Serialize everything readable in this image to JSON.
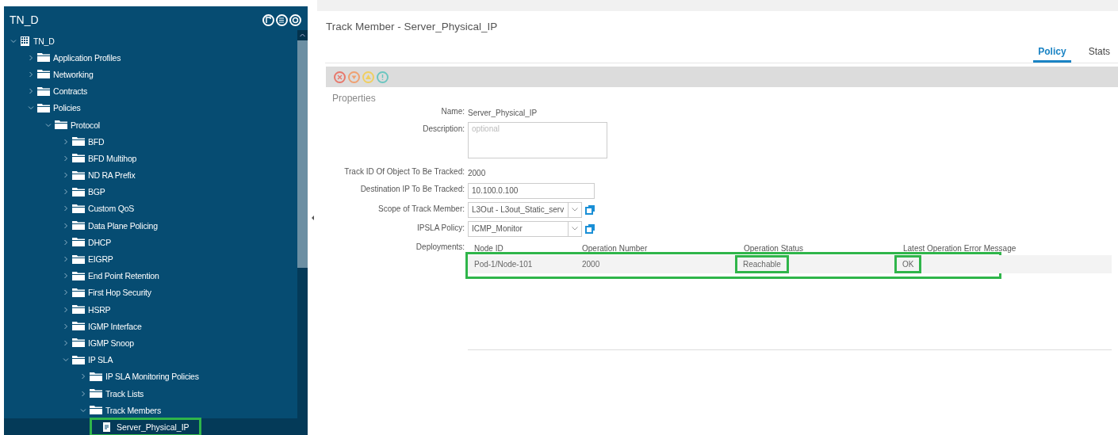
{
  "sidebar": {
    "title": "TN_D",
    "tree": [
      {
        "label": "TN_D",
        "kind": "tenant",
        "expanded": true,
        "selected": false,
        "children": [
          {
            "label": "Application Profiles",
            "kind": "folder",
            "expanded": false,
            "selected": false
          },
          {
            "label": "Networking",
            "kind": "folder",
            "expanded": false,
            "selected": false
          },
          {
            "label": "Contracts",
            "kind": "folder",
            "expanded": false,
            "selected": false
          },
          {
            "label": "Policies",
            "kind": "folder",
            "expanded": true,
            "selected": false,
            "children": [
              {
                "label": "Protocol",
                "kind": "folder",
                "expanded": true,
                "selected": false,
                "children": [
                  {
                    "label": "BFD",
                    "kind": "folder",
                    "expanded": false,
                    "selected": false
                  },
                  {
                    "label": "BFD Multihop",
                    "kind": "folder",
                    "expanded": false,
                    "selected": false
                  },
                  {
                    "label": "ND RA Prefix",
                    "kind": "folder",
                    "expanded": false,
                    "selected": false
                  },
                  {
                    "label": "BGP",
                    "kind": "folder",
                    "expanded": false,
                    "selected": false
                  },
                  {
                    "label": "Custom QoS",
                    "kind": "folder",
                    "expanded": false,
                    "selected": false
                  },
                  {
                    "label": "Data Plane Policing",
                    "kind": "folder",
                    "expanded": false,
                    "selected": false
                  },
                  {
                    "label": "DHCP",
                    "kind": "folder",
                    "expanded": false,
                    "selected": false
                  },
                  {
                    "label": "EIGRP",
                    "kind": "folder",
                    "expanded": false,
                    "selected": false
                  },
                  {
                    "label": "End Point Retention",
                    "kind": "folder",
                    "expanded": false,
                    "selected": false
                  },
                  {
                    "label": "First Hop Security",
                    "kind": "folder",
                    "expanded": false,
                    "selected": false
                  },
                  {
                    "label": "HSRP",
                    "kind": "folder",
                    "expanded": false,
                    "selected": false
                  },
                  {
                    "label": "IGMP Interface",
                    "kind": "folder",
                    "expanded": false,
                    "selected": false
                  },
                  {
                    "label": "IGMP Snoop",
                    "kind": "folder",
                    "expanded": false,
                    "selected": false
                  },
                  {
                    "label": "IP SLA",
                    "kind": "folder",
                    "expanded": true,
                    "selected": false,
                    "children": [
                      {
                        "label": "IP SLA Monitoring Policies",
                        "kind": "folder",
                        "expanded": false,
                        "selected": false
                      },
                      {
                        "label": "Track Lists",
                        "kind": "folder",
                        "expanded": false,
                        "selected": false
                      },
                      {
                        "label": "Track Members",
                        "kind": "folder",
                        "expanded": true,
                        "selected": false,
                        "children": [
                          {
                            "label": "Server_Physical_IP",
                            "kind": "file",
                            "selected": true
                          }
                        ]
                      }
                    ]
                  }
                ]
              }
            ]
          }
        ]
      }
    ]
  },
  "panel": {
    "title": "Track Member - Server_Physical_IP",
    "tabs": [
      {
        "label": "Policy",
        "selected": true
      },
      {
        "label": "Stats",
        "selected": false
      }
    ],
    "section": "Properties",
    "fields": [
      {
        "kind": "text",
        "label": "Name:",
        "value": "Server_Physical_IP"
      },
      {
        "kind": "textarea",
        "label": "Description:",
        "placeholder": "optional"
      },
      {
        "kind": "text",
        "label": "Track ID Of Object To Be Tracked:",
        "value": "2000"
      },
      {
        "kind": "input",
        "label": "Destination IP To Be Tracked:",
        "value": "10.100.0.100"
      },
      {
        "kind": "select",
        "label": "Scope of Track Member:",
        "value": "L3Out - L3out_Static_serv"
      },
      {
        "kind": "select",
        "label": "IPSLA Policy:",
        "value": "ICMP_Monitor"
      }
    ],
    "deployments": {
      "label": "Deployments:",
      "columns": [
        "Node ID",
        "Operation Number",
        "Operation Status",
        "Latest Operation Error Message"
      ],
      "rows": [
        {
          "highlighted": true,
          "cells": [
            {
              "text": "Pod-1/Node-101",
              "highlighted": false
            },
            {
              "text": "2000",
              "highlighted": false
            },
            {
              "text": "Reachable",
              "highlighted": true
            },
            {
              "text": "OK",
              "highlighted": true
            }
          ]
        }
      ]
    }
  }
}
